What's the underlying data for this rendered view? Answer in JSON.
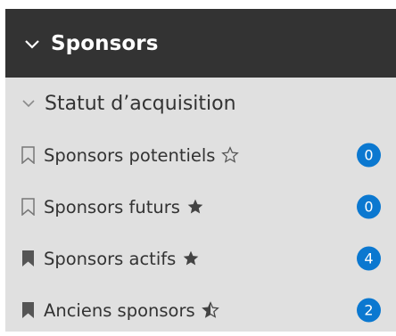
{
  "header": {
    "title": "Sponsors",
    "icon": "chevron-down-icon"
  },
  "section": {
    "label": "Statut d’acquisition",
    "icon": "chevron-down-icon"
  },
  "items": [
    {
      "label": "Sponsors potentiels",
      "count": "0",
      "bookmark": "outline",
      "star": "outline"
    },
    {
      "label": "Sponsors futurs",
      "count": "0",
      "bookmark": "outline",
      "star": "filled"
    },
    {
      "label": "Sponsors actifs",
      "count": "4",
      "bookmark": "filled",
      "star": "filled"
    },
    {
      "label": "Anciens sponsors",
      "count": "2",
      "bookmark": "filled",
      "star": "half"
    }
  ],
  "colors": {
    "header_bg": "#333333",
    "panel_bg": "#e0e0e0",
    "badge_bg": "#0b78d0",
    "text": "#333333"
  }
}
